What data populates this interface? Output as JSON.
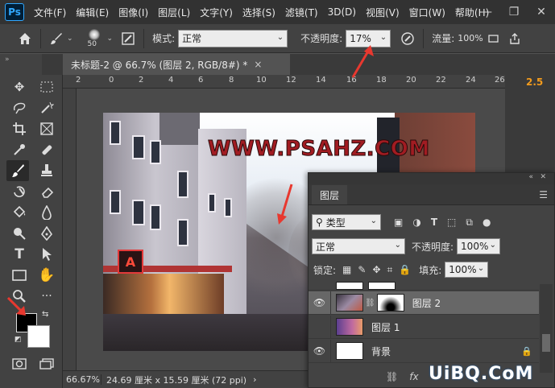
{
  "app": {
    "logo": "Ps"
  },
  "menu": [
    "文件(F)",
    "编辑(E)",
    "图像(I)",
    "图层(L)",
    "文字(Y)",
    "选择(S)",
    "滤镜(T)",
    "3D(D)",
    "视图(V)",
    "窗口(W)",
    "帮助(H)"
  ],
  "window_controls": {
    "minimize": "—",
    "maximize": "❐",
    "close": "✕"
  },
  "options": {
    "brush_size": "50",
    "mode_label": "模式:",
    "mode_value": "正常",
    "opacity_label": "不透明度:",
    "opacity_value": "17%",
    "flow_label": "流量:",
    "flow_value": "100%"
  },
  "document_tab": {
    "title": "未标题-2 @ 66.7% (图层 2, RGB/8#) *",
    "close": "×"
  },
  "ruler_ticks": [
    "2",
    "0",
    "2",
    "4",
    "6",
    "8",
    "10",
    "12",
    "14",
    "16",
    "18",
    "20",
    "22",
    "24",
    "26"
  ],
  "canvas": {
    "watermark_text": "WWW.PSAHZ.COM",
    "shop_sign": "A"
  },
  "status": {
    "zoom": "66.67%",
    "doc_size": "24.69 厘米 x 15.59 厘米 (72 ppi)",
    "arrow": "›"
  },
  "right_panel": {
    "value": "2.5"
  },
  "layers_panel": {
    "tab": "图层",
    "filter_label": "类型",
    "blend_mode": "正常",
    "opacity_label": "不透明度:",
    "opacity_value": "100%",
    "lock_label": "锁定:",
    "fill_label": "填充:",
    "fill_value": "100%",
    "layers": [
      {
        "name": "图层 2",
        "visible": true,
        "selected": true,
        "has_mask": true
      },
      {
        "name": "图层 1",
        "visible": false,
        "selected": false,
        "has_mask": false
      },
      {
        "name": "背景",
        "visible": true,
        "selected": false,
        "locked": true
      }
    ],
    "bottom": [
      "⛓",
      "fx"
    ]
  },
  "site_watermark": "UiBQ.CoM",
  "colors": {
    "accent_arrow": "#e8382f",
    "foreground": "#000000",
    "background": "#ffffff"
  }
}
